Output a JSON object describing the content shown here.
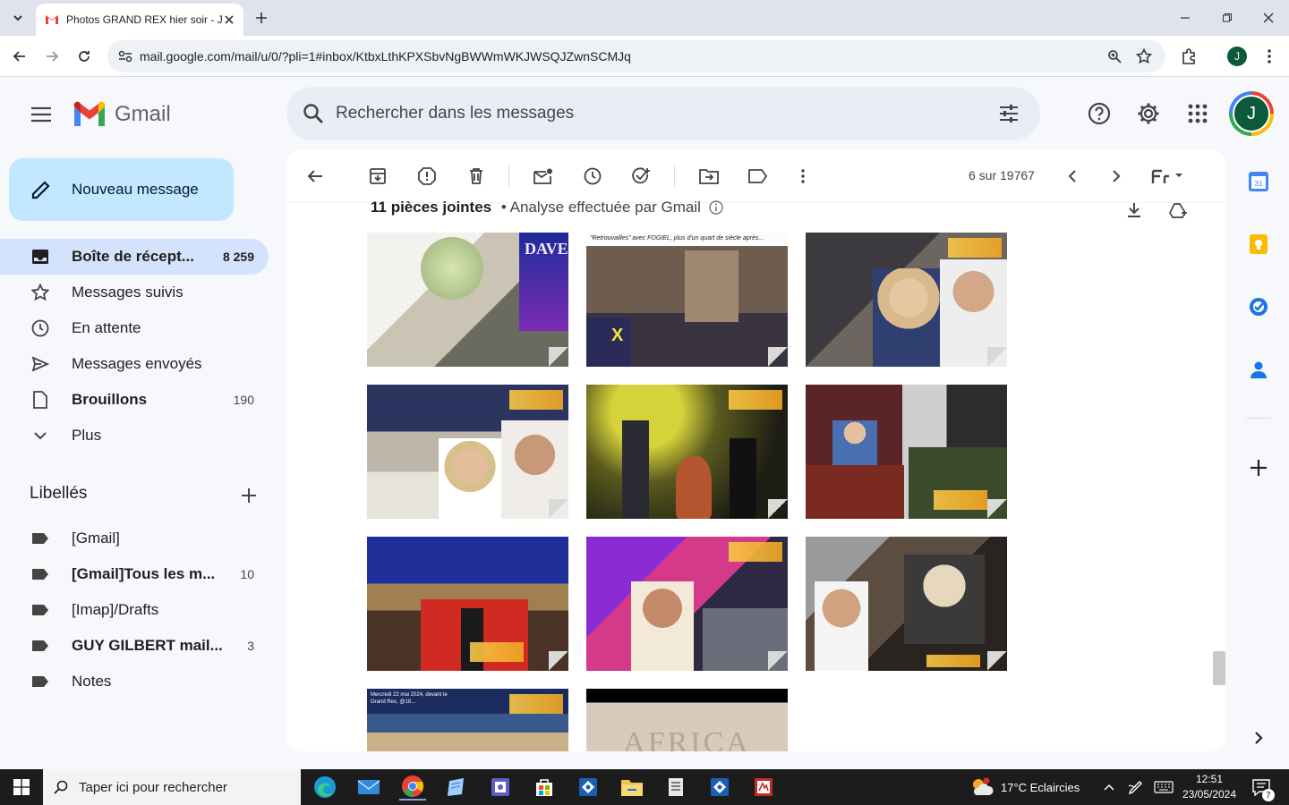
{
  "browser": {
    "tab_title": "Photos GRAND REX hier soir - J",
    "url": "mail.google.com/mail/u/0/?pli=1#inbox/KtbxLthKPXSbvNgBWWmWKJWSQJZwnSCMJq"
  },
  "gmail": {
    "product_name": "Gmail",
    "search_placeholder": "Rechercher dans les messages",
    "avatar_initial": "J",
    "compose_label": "Nouveau message"
  },
  "sidebar": {
    "items": [
      {
        "label": "Boîte de récept...",
        "count": "8 259",
        "icon": "inbox-icon",
        "active": true
      },
      {
        "label": "Messages suivis",
        "count": "",
        "icon": "star-icon"
      },
      {
        "label": "En attente",
        "count": "",
        "icon": "clock-icon"
      },
      {
        "label": "Messages envoyés",
        "count": "",
        "icon": "send-icon"
      },
      {
        "label": "Brouillons",
        "count": "190",
        "icon": "draft-icon",
        "bold": true
      },
      {
        "label": "Plus",
        "count": "",
        "icon": "chevron-down-icon"
      }
    ],
    "labels_title": "Libellés",
    "labels": [
      {
        "label": "[Gmail]",
        "count": ""
      },
      {
        "label": "[Gmail]Tous les m...",
        "count": "10",
        "bold": true
      },
      {
        "label": "[Imap]/Drafts",
        "count": ""
      },
      {
        "label": "GUY GILBERT mail...",
        "count": "3",
        "bold": true
      },
      {
        "label": "Notes",
        "count": ""
      }
    ]
  },
  "message": {
    "pager": "6 sur 19767",
    "attachments_title": "11 pièces jointes",
    "scan_text": "• Analyse effectuée par Gmail",
    "thumb_caption_2": "\"Retrouvailles\" avec FOGIEL, plus d'un quart de siècle après...",
    "thumb_caption_10": "Mercredi 22 mai 2024, devant le Grand Rex, @18...",
    "thumb_text_dave": "DAVE",
    "thumb_text_africa": "AFRICA"
  },
  "taskbar": {
    "search_placeholder": "Taper ici pour rechercher",
    "weather": "17°C  Eclaircies",
    "time": "12:51",
    "date": "23/05/2024",
    "notifications": "7"
  }
}
